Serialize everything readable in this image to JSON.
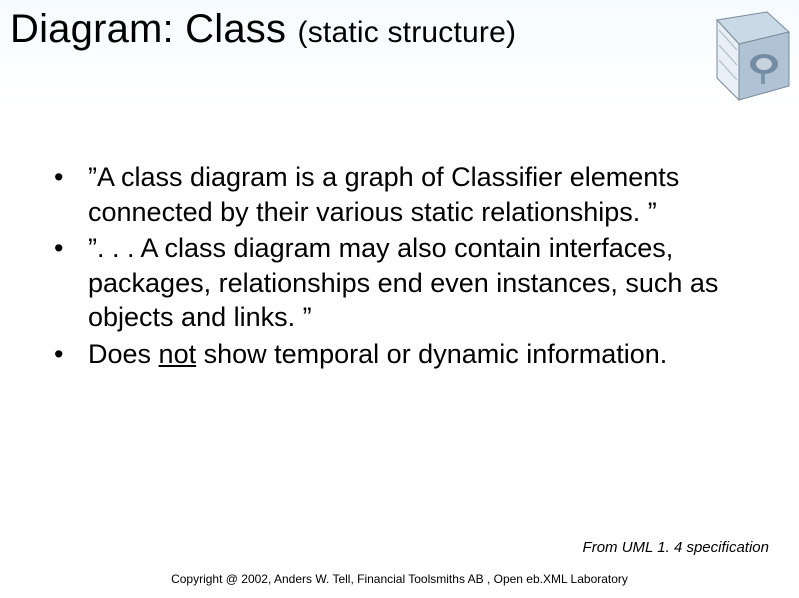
{
  "title": {
    "main": "Diagram: Class ",
    "sub": " (static structure)"
  },
  "bullets": {
    "items": [
      {
        "text": "”A class diagram is a graph of Classifier elements connected by their various static relationships. ”"
      },
      {
        "text": "”. . . A class diagram may also contain interfaces, packages, relationships end even instances, such as objects and links. ”"
      },
      {
        "prefix": "Does ",
        "underlined": "not",
        "suffix": " show temporal or dynamic information."
      }
    ]
  },
  "source": "From UML 1. 4 specification",
  "copyright": "Copyright @ 2002, Anders W. Tell, Financial Toolsmiths AB , Open eb.XML Laboratory"
}
